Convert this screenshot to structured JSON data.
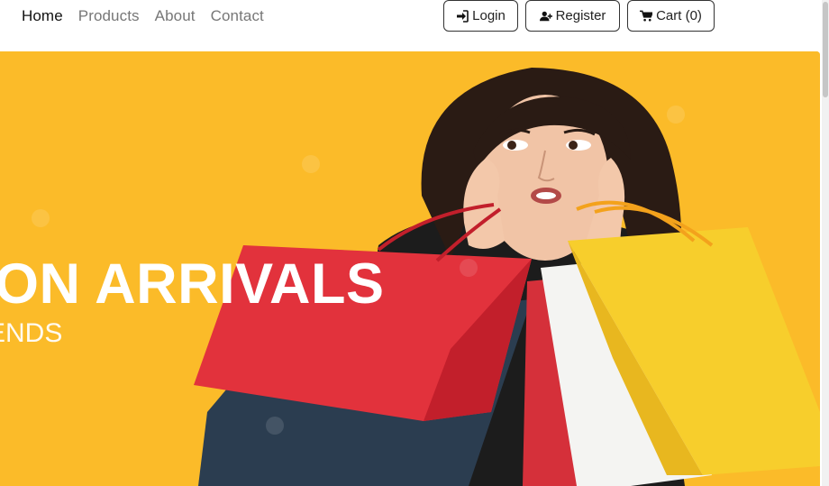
{
  "nav": {
    "links": [
      "Home",
      "Products",
      "About",
      "Contact"
    ],
    "login_label": "Login",
    "register_label": "Register",
    "cart_label": "Cart (0)"
  },
  "hero": {
    "title": "ON ARRIVALS",
    "subtitle": "ENDS",
    "background_color": "#fbbb29"
  },
  "icons": {
    "login": "sign-in-icon",
    "register": "user-plus-icon",
    "cart": "shopping-cart-icon"
  }
}
